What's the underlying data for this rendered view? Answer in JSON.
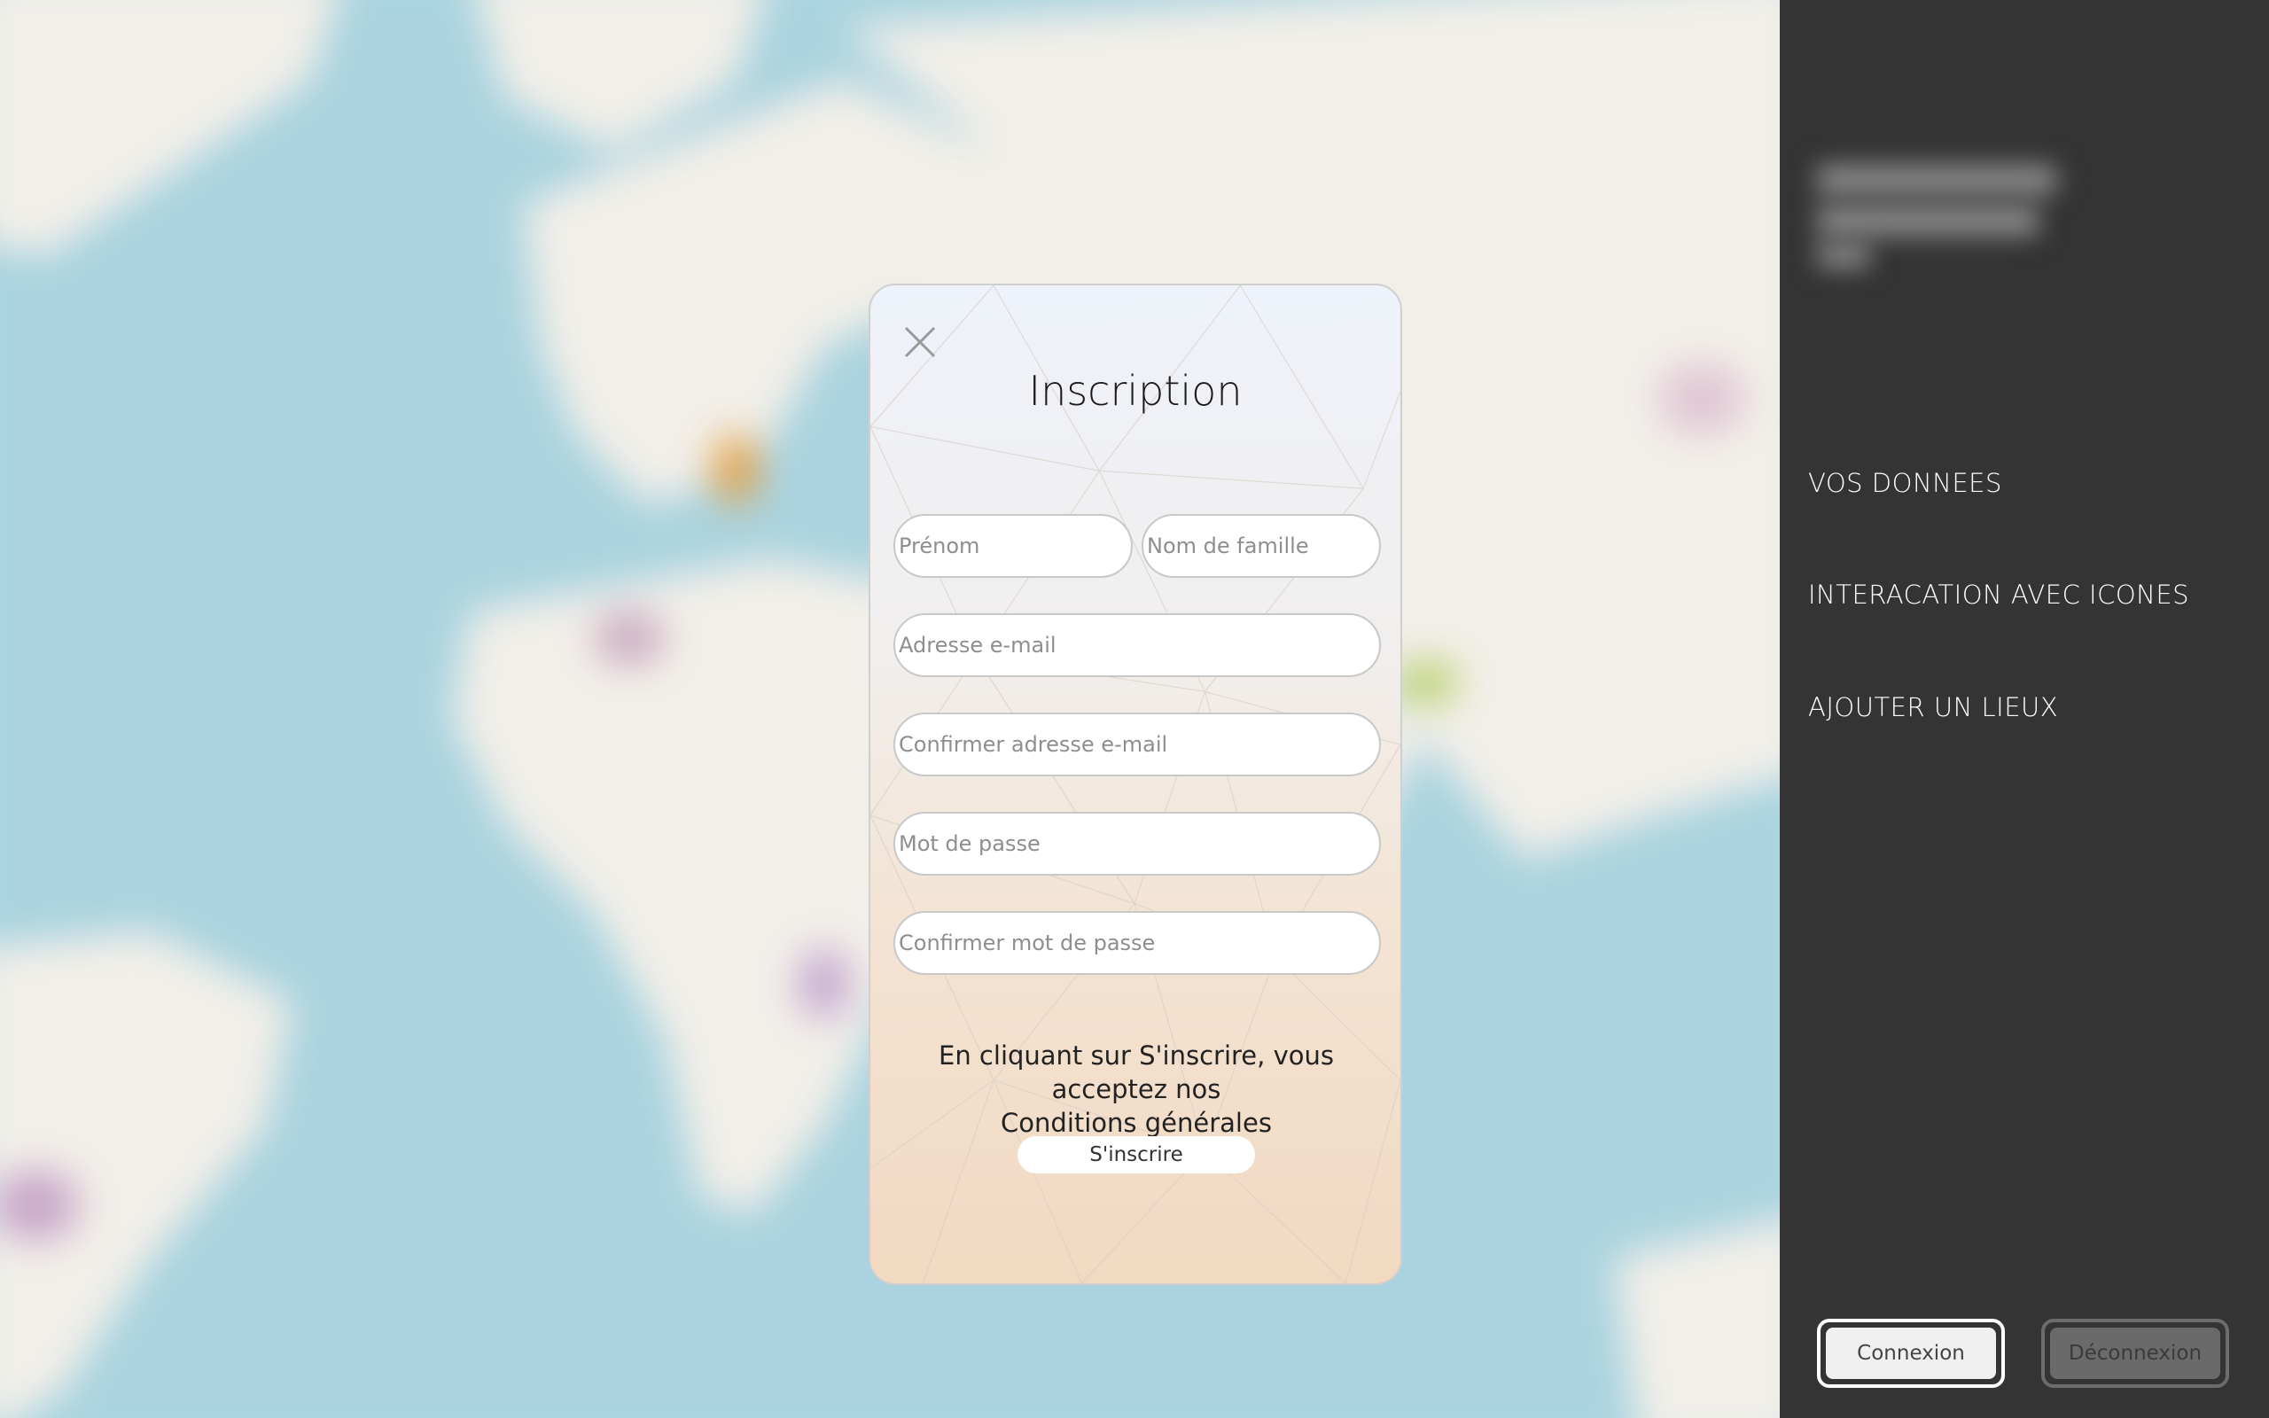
{
  "modal": {
    "title": "Inscription",
    "fields": {
      "first_name": {
        "placeholder": "Prénom",
        "value": ""
      },
      "last_name": {
        "placeholder": "Nom de famille",
        "value": ""
      },
      "email": {
        "placeholder": "Adresse e-mail",
        "value": ""
      },
      "email_confirm": {
        "placeholder": "Confirmer adresse e-mail",
        "value": ""
      },
      "password": {
        "placeholder": "Mot de passe",
        "value": ""
      },
      "password_confirm": {
        "placeholder": "Confirmer mot de passe",
        "value": ""
      }
    },
    "terms_prefix": "En cliquant sur S'inscrire, vous acceptez nos",
    "terms_link": "Conditions générales",
    "submit_label": "S'inscrire",
    "close_icon": "close-icon"
  },
  "sidebar": {
    "nav_items": [
      {
        "label": "VOS DONNEES"
      },
      {
        "label": "INTERACATION AVEC ICONES"
      },
      {
        "label": "AJOUTER UN LIEUX"
      }
    ],
    "login_label": "Connexion",
    "logout_label": "Déconnexion"
  },
  "colors": {
    "sidebar_bg": "#343434",
    "map_water": "#aad3df",
    "map_land": "#f2efe9"
  }
}
